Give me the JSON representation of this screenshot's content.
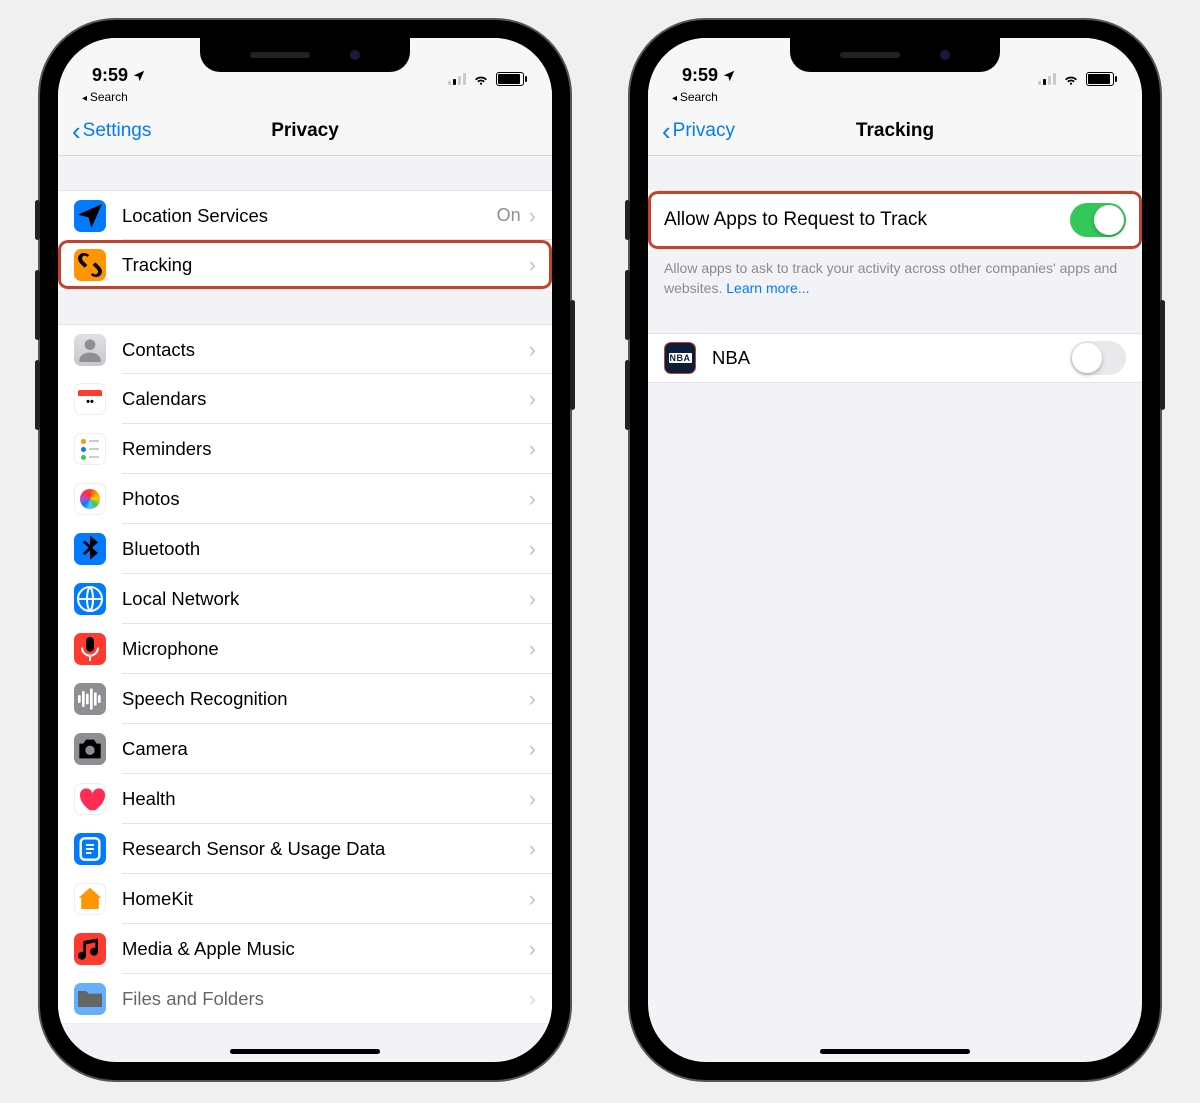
{
  "status": {
    "time": "9:59",
    "breadcrumb": "Search"
  },
  "left": {
    "back": "Settings",
    "title": "Privacy",
    "group1": [
      {
        "label": "Location Services",
        "value": "On",
        "icon": "location",
        "bg": "#007aff"
      },
      {
        "label": "Tracking",
        "icon": "tracking",
        "bg": "#ff9500",
        "highlight": true
      }
    ],
    "group2": [
      {
        "label": "Contacts",
        "icon": "contacts",
        "bg": "#d8d8dc"
      },
      {
        "label": "Calendars",
        "icon": "calendars",
        "bg": "#ffffff"
      },
      {
        "label": "Reminders",
        "icon": "reminders",
        "bg": "#ffffff"
      },
      {
        "label": "Photos",
        "icon": "photos",
        "bg": "#ffffff"
      },
      {
        "label": "Bluetooth",
        "icon": "bluetooth",
        "bg": "#007aff"
      },
      {
        "label": "Local Network",
        "icon": "localnetwork",
        "bg": "#007aff"
      },
      {
        "label": "Microphone",
        "icon": "microphone",
        "bg": "#ff3b30"
      },
      {
        "label": "Speech Recognition",
        "icon": "speech",
        "bg": "#8e8e93"
      },
      {
        "label": "Camera",
        "icon": "camera",
        "bg": "#8e8e93"
      },
      {
        "label": "Health",
        "icon": "health",
        "bg": "#ffffff"
      },
      {
        "label": "Research Sensor & Usage Data",
        "icon": "research",
        "bg": "#007aff"
      },
      {
        "label": "HomeKit",
        "icon": "homekit",
        "bg": "#ffffff"
      },
      {
        "label": "Media & Apple Music",
        "icon": "media",
        "bg": "#ff3b30"
      },
      {
        "label": "Files and Folders",
        "icon": "files",
        "bg": "#007aff"
      }
    ]
  },
  "right": {
    "back": "Privacy",
    "title": "Tracking",
    "allow_label": "Allow Apps to Request to Track",
    "allow_on": true,
    "footer": "Allow apps to ask to track your activity across other companies' apps and websites. ",
    "footer_link": "Learn more...",
    "apps": [
      {
        "label": "NBA",
        "icon": "nba",
        "on": false
      }
    ]
  }
}
